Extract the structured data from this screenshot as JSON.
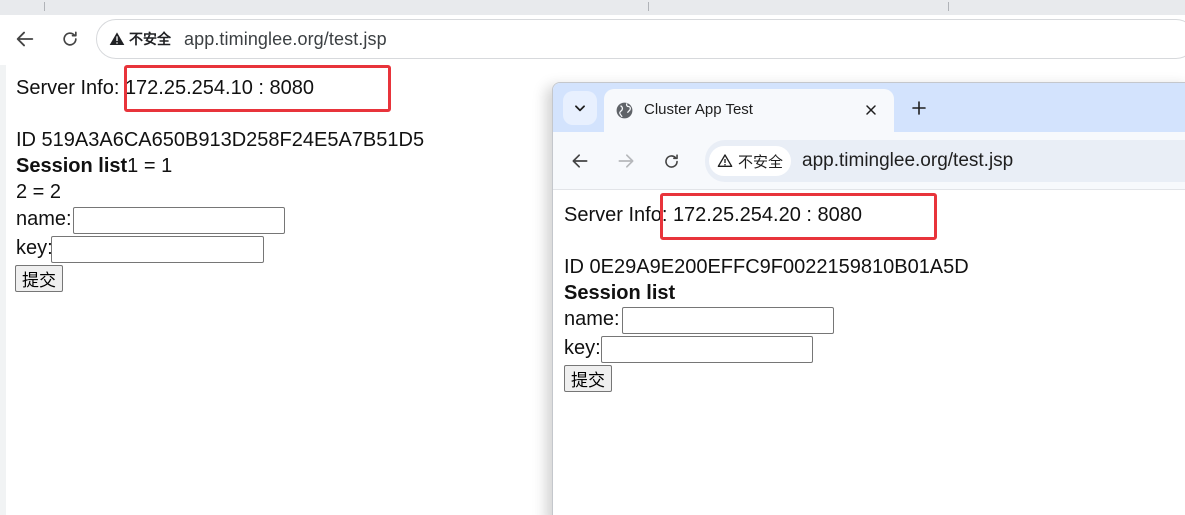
{
  "browser_back": {
    "address": {
      "security_label": "不安全",
      "url": "app.timinglee.org/test.jsp"
    },
    "page": {
      "server_info_label": "Server Info: ",
      "server_info_value": "172.25.254.10 : 8080",
      "session_id": "ID 519A3A6CA650B913D258F24E5A7B51D5",
      "session_list_label": "Session list",
      "session_entries": [
        "1 = 1",
        "2 = 2"
      ],
      "name_label": "name:",
      "name_value": "",
      "key_label": "key:",
      "key_value": "",
      "submit_label": "提交"
    }
  },
  "browser_front": {
    "tab": {
      "title": "Cluster App Test"
    },
    "address": {
      "security_label": "不安全",
      "url": "app.timinglee.org/test.jsp"
    },
    "page": {
      "server_info_label": "Server Info: ",
      "server_info_value": "172.25.254.20 : 8080",
      "session_id": "ID 0E29A9E200EFFC9F0022159810B01A5D",
      "session_list_label": "Session list",
      "name_label": "name:",
      "name_value": "",
      "key_label": "key:",
      "key_value": "",
      "submit_label": "提交"
    }
  },
  "icons": {
    "back": "arrow-left-icon",
    "forward": "arrow-right-icon",
    "reload": "reload-icon",
    "warning": "warning-triangle-icon",
    "tab_search": "chevron-down-icon",
    "favicon": "globe-icon",
    "close": "close-icon",
    "new_tab": "plus-icon"
  },
  "colors": {
    "highlight_box": "#e8343b",
    "front_tabstrip": "#d3e3fd",
    "back_tabstrip": "#e8eaed"
  }
}
